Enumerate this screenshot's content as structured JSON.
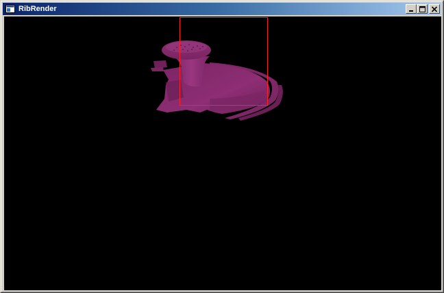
{
  "window": {
    "title": "RibRender",
    "icon": "app-window-icon",
    "buttons": {
      "minimize": "minimize-icon",
      "maximize": "maximize-icon",
      "close": "close-icon"
    }
  },
  "colors": {
    "titlebar_start": "#0a246a",
    "titlebar_end": "#a6caf0",
    "canvas_background": "#000000",
    "object_color": "#8a2a6e",
    "bucket_outline": "#ff2020"
  }
}
